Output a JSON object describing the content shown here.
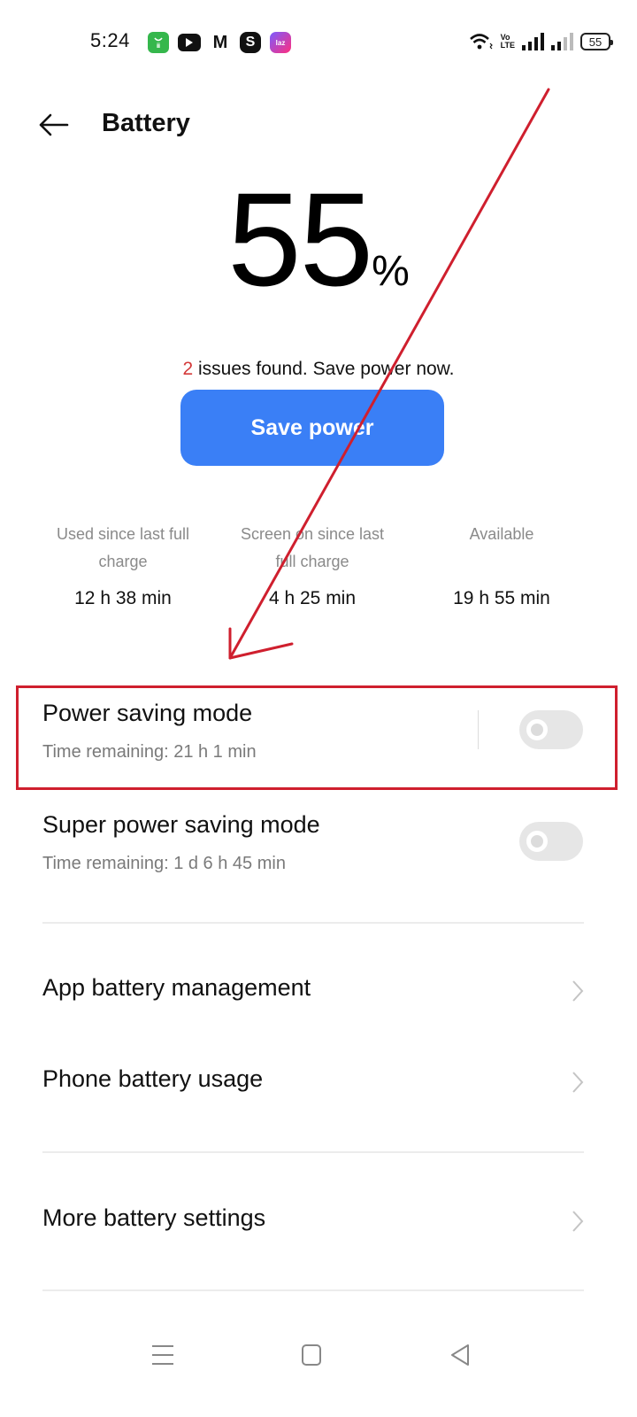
{
  "status_bar": {
    "time": "5:24",
    "notification_icons": [
      "app-store-icon",
      "youtube-icon",
      "gmail-icon",
      "s-app-icon",
      "lazada-icon"
    ],
    "lazada_label": "laz",
    "s_label": "S",
    "m_label": "M",
    "volte_line1": "Vo",
    "volte_line2": "LTE",
    "battery_level": "55"
  },
  "header": {
    "title": "Battery",
    "back_icon": "arrow-left-icon"
  },
  "battery": {
    "percent": "55",
    "percent_sign": "%",
    "issues_count": "2",
    "issues_text": " issues found. Save power now.",
    "save_button_label": "Save power",
    "accent_color": "#3a7ff6"
  },
  "stats": [
    {
      "label": "Used since last full charge",
      "value": "12 h 38 min"
    },
    {
      "label": "Screen on since last full charge",
      "value": "4 h 25 min"
    },
    {
      "label": "Available",
      "value": "19 h 55 min"
    }
  ],
  "modes": [
    {
      "title": "Power saving mode",
      "subtitle": "Time remaining:  21 h 1 min",
      "enabled": false
    },
    {
      "title": "Super power saving mode",
      "subtitle": "Time remaining:  1 d 6 h 45 min",
      "enabled": false
    }
  ],
  "menu": [
    {
      "label": "App battery management"
    },
    {
      "label": "Phone battery usage"
    },
    {
      "label": "More battery settings"
    }
  ],
  "system_nav": {
    "recents": "menu-icon",
    "home": "home-icon",
    "back": "back-triangle-icon"
  },
  "annotation": {
    "color": "#cf1f2e",
    "highlight_target": "Power saving mode"
  }
}
